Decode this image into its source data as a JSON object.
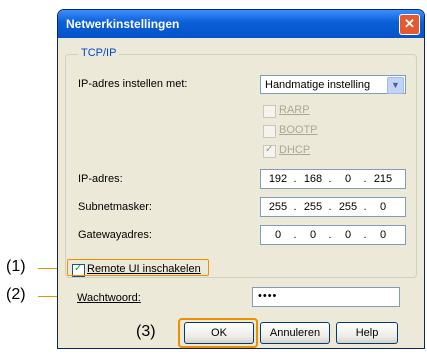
{
  "window": {
    "title": "Netwerkinstellingen",
    "close_symbol": "✕"
  },
  "tcpip": {
    "group_title": "TCP/IP",
    "set_ip_label": "IP-adres instellen met:",
    "set_ip_value": "Handmatige instelling",
    "rarp_label": "RARP",
    "bootp_label": "BOOTP",
    "dhcp_label": "DHCP",
    "ip_label": "IP-adres:",
    "ip": [
      "192",
      "168",
      "0",
      "215"
    ],
    "subnet_label": "Subnetmasker:",
    "subnet": [
      "255",
      "255",
      "255",
      "0"
    ],
    "gateway_label": "Gatewayadres:",
    "gateway": [
      "0",
      "0",
      "0",
      "0"
    ]
  },
  "remote_ui": {
    "checkbox_label": "Remote UI inschakelen",
    "checked": true
  },
  "password": {
    "label": "Wachtwoord:",
    "value": "••••"
  },
  "buttons": {
    "ok": "OK",
    "cancel": "Annuleren",
    "help": "Help"
  },
  "callouts": {
    "c1": "(1)",
    "c2": "(2)",
    "c3": "(3)"
  },
  "colors": {
    "accent": "#f08d00",
    "title_bar": "#0a5fd8"
  }
}
